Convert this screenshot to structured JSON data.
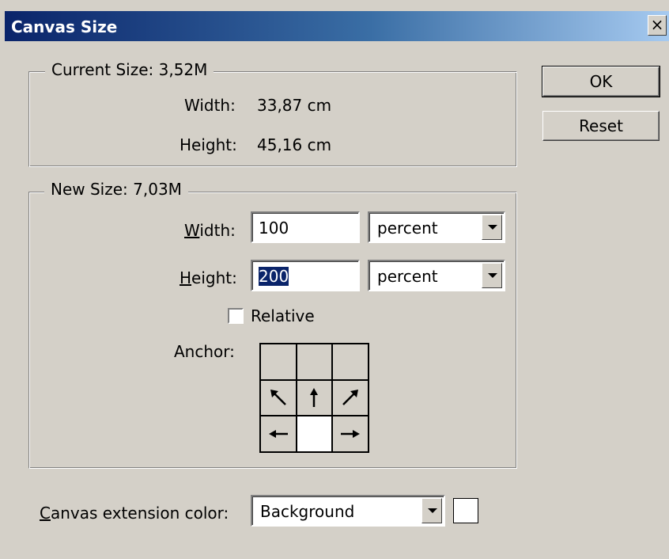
{
  "window": {
    "title": "Canvas Size",
    "close_glyph": "×"
  },
  "current_size": {
    "legend": "Current Size: 3,52M",
    "width_label": "Width:",
    "width_value": "33,87 cm",
    "height_label": "Height:",
    "height_value": "45,16 cm"
  },
  "new_size": {
    "legend": "New Size: 7,03M",
    "width_label_mnemonic": "W",
    "width_label_rest": "idth:",
    "width_value": "100",
    "width_unit": "percent",
    "height_label_mnemonic": "H",
    "height_label_rest": "eight:",
    "height_value": "200",
    "height_unit": "percent",
    "relative_label": "Relative",
    "relative_checked": false,
    "anchor_label": "Anchor:",
    "anchor_icons": [
      "",
      "",
      "",
      "arrow-up-left-icon",
      "arrow-up-icon",
      "arrow-up-right-icon",
      "arrow-left-icon",
      "anchor-center",
      "arrow-right-icon"
    ]
  },
  "buttons": {
    "ok": "OK",
    "reset": "Reset"
  },
  "extension": {
    "label_mnemonic": "C",
    "label_rest": "anvas extension color:",
    "value": "Background",
    "swatch_color": "#ffffff"
  },
  "colors": {
    "titlebar_start": "#0a246a",
    "titlebar_end": "#a6caf0",
    "dialog_bg": "#d4d0c8"
  }
}
